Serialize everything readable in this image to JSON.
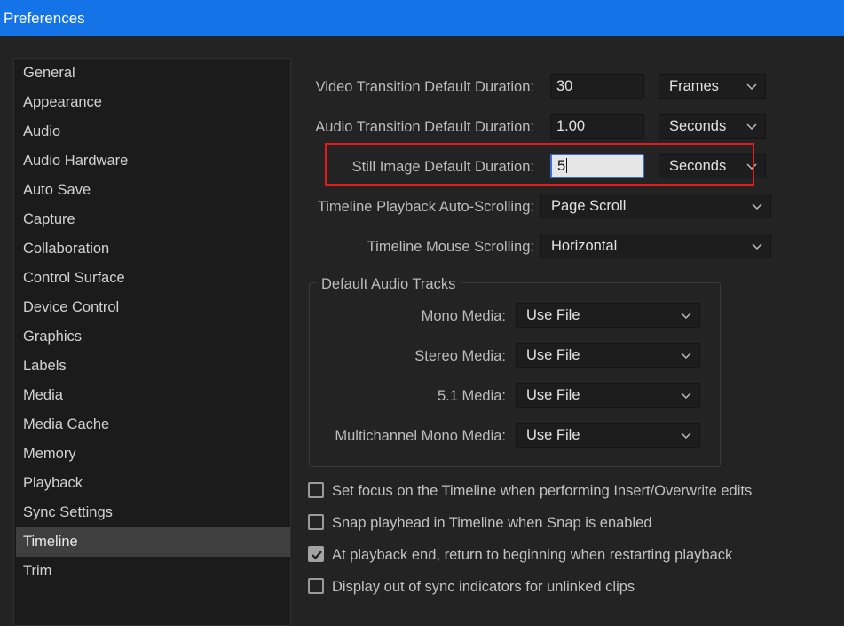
{
  "window": {
    "title": "Preferences"
  },
  "sidebar": {
    "items": [
      {
        "label": "General"
      },
      {
        "label": "Appearance"
      },
      {
        "label": "Audio"
      },
      {
        "label": "Audio Hardware"
      },
      {
        "label": "Auto Save"
      },
      {
        "label": "Capture"
      },
      {
        "label": "Collaboration"
      },
      {
        "label": "Control Surface"
      },
      {
        "label": "Device Control"
      },
      {
        "label": "Graphics"
      },
      {
        "label": "Labels"
      },
      {
        "label": "Media"
      },
      {
        "label": "Media Cache"
      },
      {
        "label": "Memory"
      },
      {
        "label": "Playback"
      },
      {
        "label": "Sync Settings"
      },
      {
        "label": "Timeline"
      },
      {
        "label": "Trim"
      }
    ],
    "selected": "Timeline"
  },
  "timeline": {
    "video_transition": {
      "label": "Video Transition Default Duration:",
      "value": "30",
      "unit": "Frames"
    },
    "audio_transition": {
      "label": "Audio Transition Default Duration:",
      "value": "1.00",
      "unit": "Seconds"
    },
    "still_image": {
      "label": "Still Image Default Duration:",
      "value": "5",
      "unit": "Seconds"
    },
    "playback_scrolling": {
      "label": "Timeline Playback Auto-Scrolling:",
      "value": "Page Scroll"
    },
    "mouse_scrolling": {
      "label": "Timeline Mouse Scrolling:",
      "value": "Horizontal"
    },
    "default_audio_tracks": {
      "title": "Default Audio Tracks",
      "mono": {
        "label": "Mono Media:",
        "value": "Use File"
      },
      "stereo": {
        "label": "Stereo Media:",
        "value": "Use File"
      },
      "five_one": {
        "label": "5.1 Media:",
        "value": "Use File"
      },
      "multichannel": {
        "label": "Multichannel Mono Media:",
        "value": "Use File"
      }
    },
    "checkboxes": [
      {
        "label": "Set focus on the Timeline when performing Insert/Overwrite edits",
        "checked": false
      },
      {
        "label": "Snap playhead in Timeline when Snap is enabled",
        "checked": false
      },
      {
        "label": "At playback end, return to beginning when restarting playback",
        "checked": true
      },
      {
        "label": "Display out of sync indicators for unlinked clips",
        "checked": false
      }
    ]
  },
  "colors": {
    "titlebar": "#1473e6",
    "highlight_box": "#e31b1b",
    "background": "#232323"
  }
}
